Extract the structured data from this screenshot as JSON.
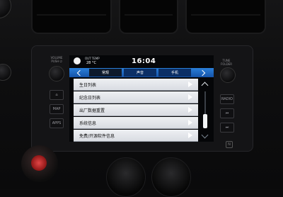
{
  "status": {
    "out_temp_label": "OUT TEMP",
    "out_temp_value": "28 °C",
    "clock": "16:04"
  },
  "tabs": [
    {
      "label": "常规",
      "state": "selected"
    },
    {
      "label": "声音",
      "state": "normal"
    },
    {
      "label": "手机",
      "state": "normal"
    }
  ],
  "settings_list": [
    {
      "label": "生日列表"
    },
    {
      "label": "纪念日列表"
    },
    {
      "label": "出厂数据重置"
    },
    {
      "label": "系统信息"
    },
    {
      "label": "免费/开源软件信息"
    }
  ],
  "head_unit": {
    "volume_label": "VOLUME",
    "volume_sub": "PUSH ⏻",
    "tune_label": "TUNE",
    "tune_sub": "FOLDER",
    "left_buttons": [
      "⌂",
      "MAP",
      "APPS"
    ],
    "right_buttons": [
      "RADIO",
      "⏮",
      "⏭"
    ]
  },
  "colors": {
    "tab_bar": "#1f6fd0",
    "row_bg": "#e6e8ec",
    "screen_bg": "#050608"
  }
}
